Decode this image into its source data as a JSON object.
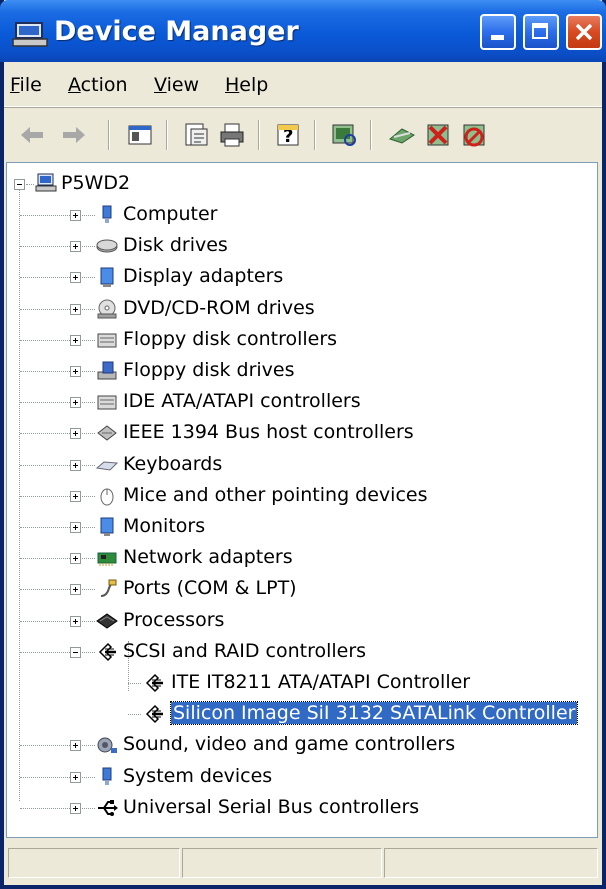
{
  "window": {
    "title": "Device Manager"
  },
  "menu": {
    "file": "File",
    "action": "Action",
    "view": "View",
    "help": "Help"
  },
  "toolbar": {
    "buttons": [
      "back-icon",
      "forward-icon",
      "show-hide-console-tree-icon",
      "properties-icon",
      "print-icon",
      "help-icon",
      "scan-hardware-icon",
      "update-driver-icon",
      "uninstall-icon",
      "disable-icon"
    ]
  },
  "tree": {
    "root": "P5WD2",
    "items": [
      {
        "label": "Computer",
        "icon": "computer-icon"
      },
      {
        "label": "Disk drives",
        "icon": "disk-drive-icon"
      },
      {
        "label": "Display adapters",
        "icon": "display-adapter-icon"
      },
      {
        "label": "DVD/CD-ROM drives",
        "icon": "cdrom-icon"
      },
      {
        "label": "Floppy disk controllers",
        "icon": "floppy-controller-icon"
      },
      {
        "label": "Floppy disk drives",
        "icon": "floppy-drive-icon"
      },
      {
        "label": "IDE ATA/ATAPI controllers",
        "icon": "ide-controller-icon"
      },
      {
        "label": "IEEE 1394 Bus host controllers",
        "icon": "ieee1394-icon"
      },
      {
        "label": "Keyboards",
        "icon": "keyboard-icon"
      },
      {
        "label": "Mice and other pointing devices",
        "icon": "mouse-icon"
      },
      {
        "label": "Monitors",
        "icon": "monitor-icon"
      },
      {
        "label": "Network adapters",
        "icon": "network-adapter-icon"
      },
      {
        "label": "Ports (COM & LPT)",
        "icon": "port-icon"
      },
      {
        "label": "Processors",
        "icon": "processor-icon"
      },
      {
        "label": "SCSI and RAID controllers",
        "icon": "scsi-icon"
      },
      {
        "label": "ITE IT8211 ATA/ATAPI Controller",
        "icon": "scsi-device-icon"
      },
      {
        "label": "Silicon Image SiI 3132 SATALink Controller",
        "icon": "scsi-device-icon"
      },
      {
        "label": "Sound, video and game controllers",
        "icon": "sound-icon"
      },
      {
        "label": "System devices",
        "icon": "system-device-icon"
      },
      {
        "label": "Universal Serial Bus controllers",
        "icon": "usb-icon"
      }
    ]
  },
  "colors": {
    "titlebar": "#0A5AD8",
    "selection": "#316AC5",
    "close": "#D74A22"
  }
}
